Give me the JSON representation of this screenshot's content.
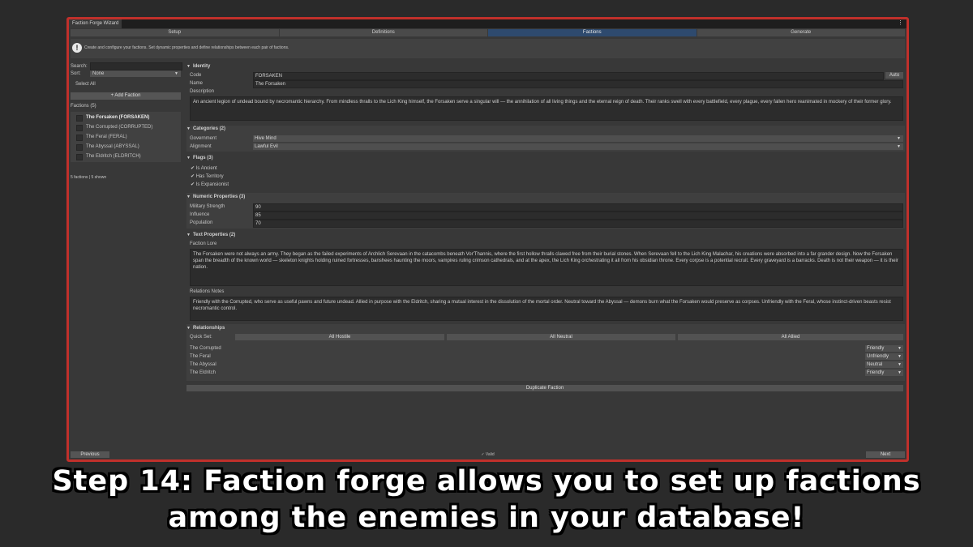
{
  "window": {
    "title": "Faction Forge Wizard",
    "menu_icon": "⋮",
    "tabs": [
      {
        "label": "Setup",
        "active": false
      },
      {
        "label": "Definitions",
        "active": false
      },
      {
        "label": "Factions",
        "active": true
      },
      {
        "label": "Generate",
        "active": false
      }
    ]
  },
  "info": {
    "icon": "!",
    "text": "Create and configure your factions. Set dynamic properties and define relationships between each pair of factions."
  },
  "left": {
    "search_label": "Search:",
    "search_value": "",
    "sort_label": "Sort:",
    "sort_value": "None",
    "select_all": "Select All",
    "add_faction": "+ Add Faction",
    "list_header": "Factions (5)",
    "factions": [
      {
        "label": "The Forsaken (FORSAKEN)",
        "selected": true
      },
      {
        "label": "The Corrupted (CORRUPTED)",
        "selected": false
      },
      {
        "label": "The Feral (FERAL)",
        "selected": false
      },
      {
        "label": "The Abyssal (ABYSSAL)",
        "selected": false
      },
      {
        "label": "The Eldritch (ELDRITCH)",
        "selected": false
      }
    ],
    "footer": "5 factions | 5 shown"
  },
  "identity": {
    "header": "Identity",
    "code_label": "Code",
    "code_value": "FORSAKEN",
    "auto_button": "Auto",
    "name_label": "Name",
    "name_value": "The Forsaken",
    "description_label": "Description",
    "description_value": "An ancient legion of undead bound by necromantic hierarchy. From mindless thralls to the Lich King himself, the Forsaken serve a singular will — the annihilation of all living things and the eternal reign of death. Their ranks swell with every battlefield, every plague, every fallen hero reanimated in mockery of their former glory."
  },
  "categories": {
    "header": "Categories (2)",
    "items": [
      {
        "label": "Government",
        "value": "Hive Mind"
      },
      {
        "label": "Alignment",
        "value": "Lawful Evil"
      }
    ]
  },
  "flags": {
    "header": "Flags (3)",
    "items": [
      {
        "label": "Is Ancient",
        "checked": true
      },
      {
        "label": "Has Territory",
        "checked": true
      },
      {
        "label": "Is Expansionist",
        "checked": true
      }
    ]
  },
  "numeric": {
    "header": "Numeric Properties (3)",
    "items": [
      {
        "label": "Military Strength",
        "value": "90"
      },
      {
        "label": "Influence",
        "value": "85"
      },
      {
        "label": "Population",
        "value": "70"
      }
    ]
  },
  "text_props": {
    "header": "Text Properties (2)",
    "lore_label": "Faction Lore",
    "lore_value": "The Forsaken were not always an army. They began as the failed experiments of Archlich Serevaan in the catacombs beneath Vor'Thannis, where the first hollow thralls clawed free from their burial stones. When Serevaan fell to the Lich King Malachar, his creations were absorbed into a far grander design. Now the Forsaken span the breadth of the known world — skeleton knights holding ruined fortresses, banshees haunting the moors, vampires ruling crimson cathedrals, and at the apex, the Lich King orchestrating it all from his obsidian throne. Every corpse is a potential recruit. Every graveyard is a barracks. Death is not their weapon — it is their nation.",
    "notes_label": "Relations Notes",
    "notes_value": "Friendly with the Corrupted, who serve as useful pawns and future undead. Allied in purpose with the Eldritch, sharing a mutual interest in the dissolution of the mortal order. Neutral toward the Abyssal — demons burn what the Forsaken would preserve as corpses. Unfriendly with the Feral, whose instinct-driven beasts resist necromantic control."
  },
  "relationships": {
    "header": "Relationships",
    "quick_set_label": "Quick Set:",
    "quick_buttons": [
      "All Hostile",
      "All Neutral",
      "All Allied"
    ],
    "items": [
      {
        "label": "The Corrupted",
        "value": "Friendly"
      },
      {
        "label": "The Feral",
        "value": "Unfriendly"
      },
      {
        "label": "The Abyssal",
        "value": "Neutral"
      },
      {
        "label": "The Eldritch",
        "value": "Friendly"
      }
    ]
  },
  "duplicate_button": "Duplicate Faction",
  "footer": {
    "previous": "Previous",
    "status": "✓ Valid",
    "next": "Next"
  },
  "caption": {
    "line1": "Step 14: Faction forge allows you to set up factions",
    "line2": "among the enemies in your database!"
  },
  "colors": {
    "frame_border": "#c0302b",
    "active_tab": "#2e4a6e",
    "background": "#2a2a2a"
  }
}
